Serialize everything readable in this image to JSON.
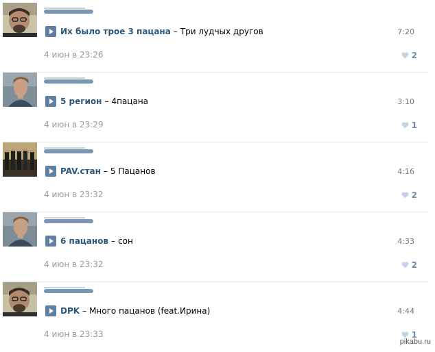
{
  "posts": [
    {
      "artist": "Их было трое 3 пацана",
      "dash": "–",
      "title": "Три лудчых другов",
      "duration": "7:20",
      "date": "4 июн в 23:26",
      "likes": "2"
    },
    {
      "artist": "5 регион",
      "dash": "–",
      "title": "4пацана",
      "duration": "3:10",
      "date": "4 июн в 23:29",
      "likes": "1"
    },
    {
      "artist": "PAV.стан",
      "dash": "–",
      "title": "5 Пацанов",
      "duration": "4:16",
      "date": "4 июн в 23:32",
      "likes": "2"
    },
    {
      "artist": "6 пацанов",
      "dash": "–",
      "title": "сон",
      "duration": "4:33",
      "date": "4 июн в 23:32",
      "likes": "2"
    },
    {
      "artist": "DPK",
      "dash": "–",
      "title": "Много пацанов (feat.Ирина)",
      "duration": "4:44",
      "date": "4 июн в 23:33",
      "likes": "1"
    }
  ],
  "watermark": "pikabu.ru",
  "colors": {
    "link": "#2b587a",
    "play_button": "#5f7fa3",
    "like": "#6a8bb0",
    "meta": "#999999",
    "separator": "#e7e8ec"
  }
}
